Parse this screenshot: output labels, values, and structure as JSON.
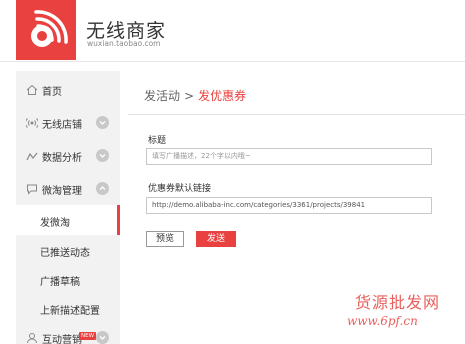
{
  "brand": {
    "title": "无线商家",
    "subtitle": "wuxian.taobao.com",
    "color": "#e9413f"
  },
  "sidebar": {
    "items": [
      {
        "label": "首页",
        "icon": "home-icon",
        "expandable": false
      },
      {
        "label": "无线店铺",
        "icon": "radio-signal-icon",
        "expandable": true
      },
      {
        "label": "数据分析",
        "icon": "chart-line-icon",
        "expandable": true
      },
      {
        "label": "微淘管理",
        "icon": "chat-bubble-icon",
        "expandable": true,
        "expanded": true
      },
      {
        "label": "互动营销",
        "icon": "user-icon",
        "expandable": true,
        "badge": "NEW"
      }
    ],
    "sub_items": [
      {
        "label": "发微淘",
        "active": true
      },
      {
        "label": "已推送动态",
        "active": false
      },
      {
        "label": "广播草稿",
        "active": false
      },
      {
        "label": "上新描述配置",
        "active": false
      }
    ]
  },
  "main": {
    "breadcrumb": {
      "root": "发活动",
      "separator": ">",
      "current": "发优惠券"
    },
    "title_field": {
      "label": "标题",
      "placeholder": "填写广播描述，22个字以内哦~"
    },
    "link_field": {
      "label": "优惠券默认链接",
      "value": "http://demo.alibaba-inc.com/categories/3361/projects/39841"
    },
    "buttons": {
      "preview": "预览",
      "send": "发送"
    }
  },
  "watermark": {
    "title": "货源批发网",
    "url": "www.6pf.cn"
  }
}
